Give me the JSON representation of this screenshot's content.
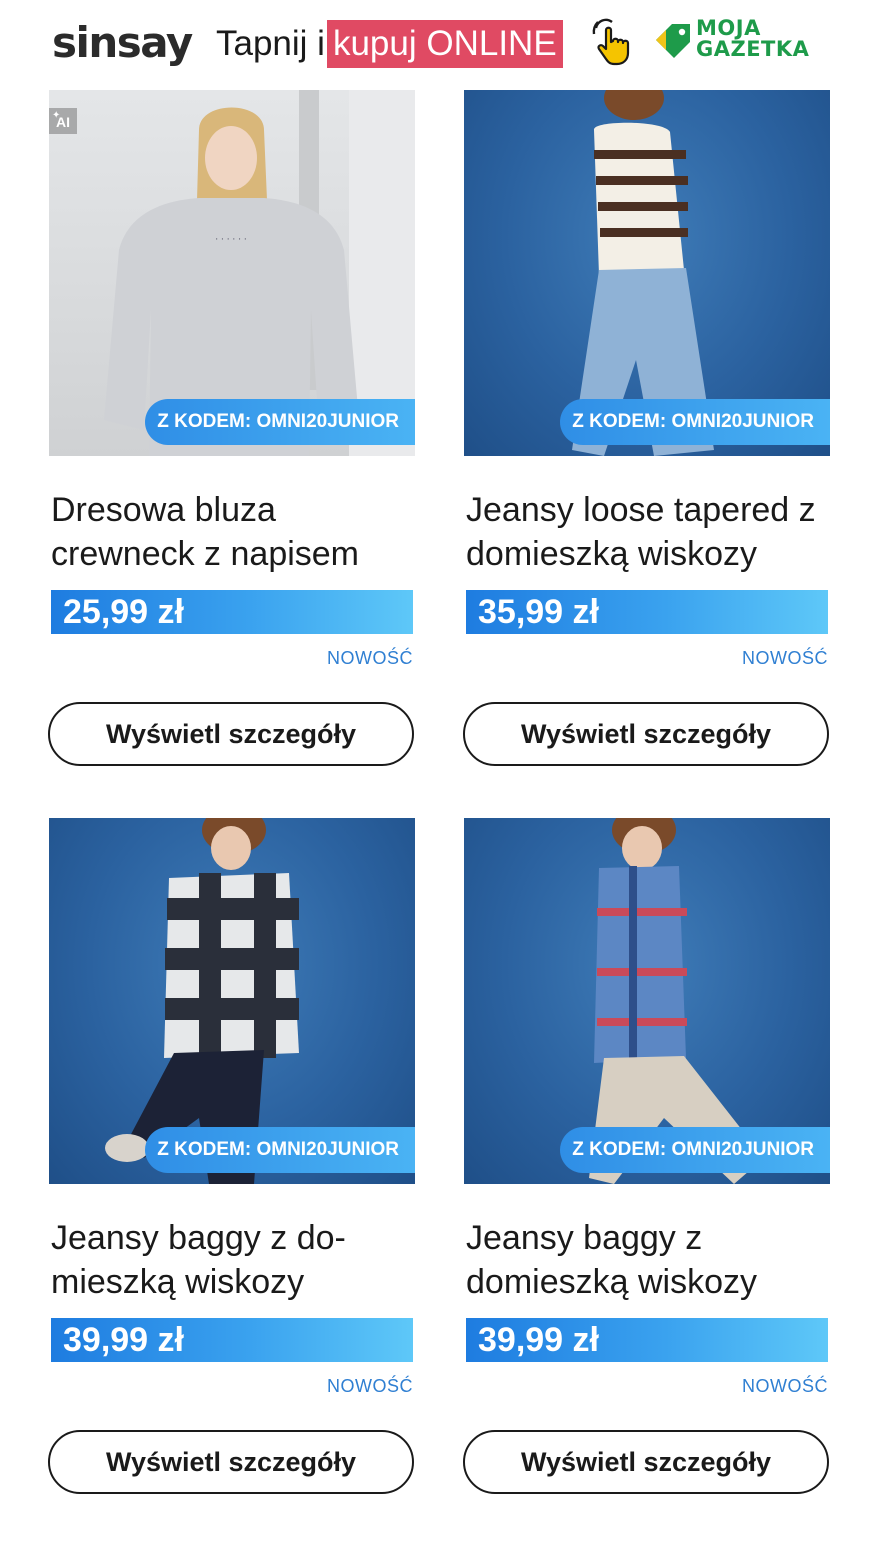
{
  "header": {
    "logo_text": "sinsay",
    "promo_prefix": "Tapnij i",
    "promo_highlight": "kupuj ONLINE",
    "tap_icon": "hand-pointer-icon",
    "partner_logo": {
      "line1": "MOJA",
      "line2": "GAZETKA",
      "icon": "tag-icon"
    }
  },
  "colors": {
    "promo_highlight": "#e04a63",
    "price_gradient_start": "#1e7ce0",
    "price_gradient_end": "#5ec8f8",
    "code_pill": "#3a9ff0",
    "new_label": "#2f7fd2",
    "partner_green": "#1e9b4a"
  },
  "products": [
    {
      "title": "Dresowa bluza crewneck z napisem",
      "price": "25,99 zł",
      "code": "Z KODEM: OMNI20JUNIOR",
      "badge": "NOWOŚĆ",
      "button": "Wyświetl szczegóły",
      "ai_badge": "AI"
    },
    {
      "title": "Jeansy loose tapered z domieszką wiskozy",
      "price": "35,99 zł",
      "code": "Z KODEM: OMNI20JUNIOR",
      "badge": "NOWOŚĆ",
      "button": "Wyświetl szczegóły"
    },
    {
      "title": "Jeansy baggy z do-mieszką wiskozy",
      "price": "39,99 zł",
      "code": "Z KODEM: OMNI20JUNIOR",
      "badge": "NOWOŚĆ",
      "button": "Wyświetl szczegóły"
    },
    {
      "title": "Jeansy baggy z domieszką wiskozy",
      "price": "39,99 zł",
      "code": "Z KODEM: OMNI20JUNIOR",
      "badge": "NOWOŚĆ",
      "button": "Wyświetl szczegóły"
    }
  ]
}
